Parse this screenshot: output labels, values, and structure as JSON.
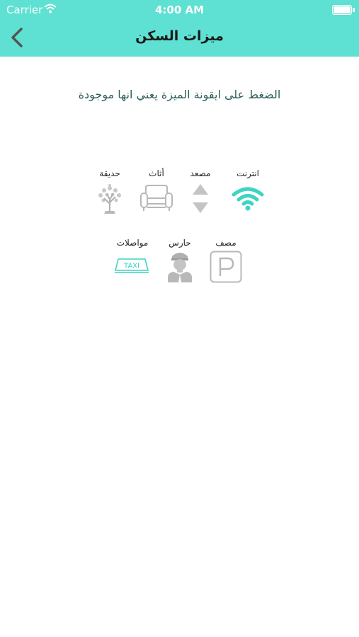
{
  "status_bar": {
    "carrier": "Carrier",
    "time": "4:00 AM"
  },
  "nav": {
    "title": "ميزات السكن",
    "back_icon": "chevron-left-icon"
  },
  "hint": "الضغط على ايقونة الميزة يعني انها موجودة",
  "colors": {
    "accent": "#5ee0d2",
    "active_icon": "#3fd4c2",
    "inactive_icon": "#b8b8b8",
    "hint_text": "#2c5e5a"
  },
  "features": [
    {
      "label": "انترنت",
      "icon": "wifi-icon",
      "active": true
    },
    {
      "label": "مصعد",
      "icon": "elevator-icon",
      "active": false
    },
    {
      "label": "أثاث",
      "icon": "armchair-icon",
      "active": false
    },
    {
      "label": "حديقة",
      "icon": "tree-icon",
      "active": false
    },
    {
      "label": "مصف",
      "icon": "parking-icon",
      "active": false
    },
    {
      "label": "حارس",
      "icon": "guard-icon",
      "active": false
    },
    {
      "label": "مواصلات",
      "icon": "taxi-icon",
      "active": true
    }
  ]
}
